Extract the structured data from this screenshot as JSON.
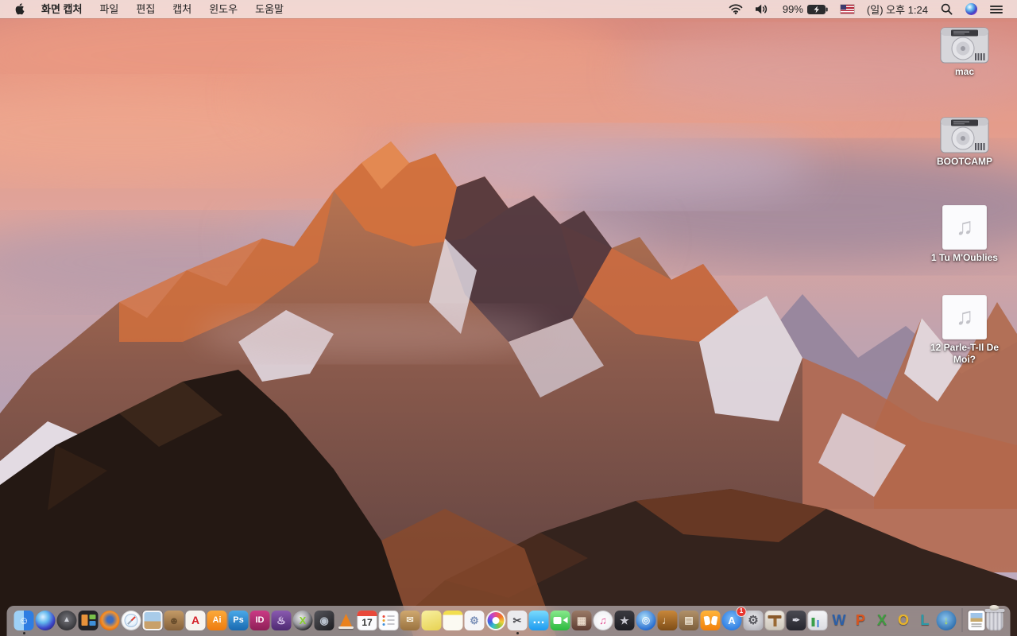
{
  "menu_bar": {
    "app_name": "화면 캡처",
    "menus": [
      "파일",
      "편집",
      "캡처",
      "윈도우",
      "도움말"
    ],
    "status": {
      "battery_percent": "99%",
      "clock": "(일) 오후 1:24",
      "icons": [
        "wifi-icon",
        "volume-icon",
        "battery-charging-icon",
        "us-flag-input-icon",
        "spotlight-search-icon",
        "siri-icon",
        "notification-center-icon"
      ]
    }
  },
  "desktop": {
    "icons": [
      {
        "name": "volume-mac",
        "label": "mac",
        "type": "hard-drive"
      },
      {
        "name": "volume-bootcamp",
        "label": "BOOTCAMP",
        "type": "hard-drive"
      },
      {
        "name": "audio-file-1",
        "label": "1 Tu M'Oublies",
        "type": "audio-file"
      },
      {
        "name": "audio-file-12",
        "label": "12 Parle-T-Il De Moi?",
        "type": "audio-file"
      }
    ]
  },
  "dock": {
    "items": [
      {
        "name": "finder",
        "label": "Finder",
        "special": "finder",
        "glyph": "☺",
        "gc": "#ffffff",
        "fs": 13,
        "running": true
      },
      {
        "name": "siri",
        "label": "Siri",
        "shape": "c",
        "bg": "radial-gradient(circle at 38% 32%,#cfeaff 4%,#62b8ee 32%,#3d46c9 62%,#21174a 95%)"
      },
      {
        "name": "launchpad",
        "label": "Launchpad",
        "shape": "c",
        "bg": "radial-gradient(circle at 50% 42%,#76767c,#303034 78%)",
        "glyph": "▲",
        "gc": "#cfd2da",
        "fs": 10
      },
      {
        "name": "mission-control",
        "label": "Mission Control",
        "special": "mc"
      },
      {
        "name": "firefox",
        "label": "Firefox",
        "shape": "c",
        "bg": "radial-gradient(circle at 52% 46%,#3d6cbf 20%,#f2932f 52%,#d95b00 82%)"
      },
      {
        "name": "safari",
        "label": "Safari",
        "special": "safari"
      },
      {
        "name": "preview",
        "label": "Preview",
        "special": "preview"
      },
      {
        "name": "contacts",
        "label": "Contacts",
        "shape": "r",
        "bg": "linear-gradient(180deg,#c39a66,#85613a)",
        "glyph": "☻",
        "gc": "rgba(58,40,16,0.55)",
        "fs": 13
      },
      {
        "name": "acrobat",
        "label": "Adobe Acrobat",
        "shape": "r",
        "bg": "#f7f4ef",
        "glyph": "A",
        "gc": "#d42029",
        "fs": 14
      },
      {
        "name": "illustrator",
        "label": "Adobe Illustrator",
        "shape": "r",
        "bg": "linear-gradient(180deg,#fba93a,#ee7c10)",
        "glyph": "Ai",
        "gc": "#ffffff",
        "fs": 11
      },
      {
        "name": "photoshop",
        "label": "Adobe Photoshop",
        "shape": "r",
        "bg": "linear-gradient(180deg,#49a8e8,#1a6ab0)",
        "glyph": "Ps",
        "gc": "#ffffff",
        "fs": 11
      },
      {
        "name": "indesign",
        "label": "Adobe InDesign",
        "shape": "r",
        "bg": "linear-gradient(180deg,#cb3a85,#8e2057)",
        "glyph": "ID",
        "gc": "#ffffff",
        "fs": 11
      },
      {
        "name": "toast-titanium",
        "label": "Toast Titanium",
        "shape": "r",
        "bg": "linear-gradient(180deg,#8a5ab0,#4e2a72)",
        "glyph": "♨",
        "gc": "#e9d9f8",
        "fs": 13
      },
      {
        "name": "xld",
        "label": "XLD",
        "shape": "c",
        "bg": "radial-gradient(circle at 40% 35%,#ececec,#9a9aa0 45%,#1e1e22 78%)",
        "glyph": "X",
        "gc": "#86d02a",
        "fs": 13
      },
      {
        "name": "disc-burner",
        "label": "Disc Burner",
        "shape": "r",
        "bg": "linear-gradient(145deg,#55555b,#1c1c20)",
        "glyph": "◉",
        "gc": "#b8c0cc",
        "fs": 13
      },
      {
        "name": "vlc",
        "label": "VLC",
        "special": "vlc"
      },
      {
        "name": "calendar",
        "label": "Calendar",
        "special": "cal",
        "glyph": "17"
      },
      {
        "name": "reminders",
        "label": "Reminders",
        "special": "rem"
      },
      {
        "name": "unarchiver",
        "label": "Unarchiver",
        "shape": "r",
        "bg": "linear-gradient(180deg,#cfa86f,#9a7340)",
        "glyph": "✉",
        "gc": "#f4ecda",
        "fs": 11
      },
      {
        "name": "stickies",
        "label": "Stickies",
        "shape": "r",
        "bg": "linear-gradient(160deg,#f8f0a0,#e7d252)"
      },
      {
        "name": "notes",
        "label": "Notes",
        "shape": "r",
        "bg": "linear-gradient(180deg,#f2de4e 22%,#fbfaf2 22%)"
      },
      {
        "name": "image-capture",
        "label": "Image Capture",
        "shape": "r",
        "bg": "#f5f5f8",
        "glyph": "⚙",
        "gc": "#7a8fb8",
        "fs": 13
      },
      {
        "name": "photos",
        "label": "Photos",
        "special": "photos"
      },
      {
        "name": "grab",
        "label": "Grab",
        "shape": "r",
        "bg": "#ebebee",
        "glyph": "✂",
        "gc": "#4a4a50",
        "fs": 13,
        "running": true
      },
      {
        "name": "messages",
        "label": "Messages",
        "shape": "r",
        "bg": "linear-gradient(180deg,#7adafc,#1d9bf0)",
        "glyph": "…",
        "gc": "#ffffff",
        "fs": 16
      },
      {
        "name": "facetime",
        "label": "FaceTime",
        "special": "facetime"
      },
      {
        "name": "photo-booth",
        "label": "Photo Booth",
        "shape": "r",
        "bg": "linear-gradient(180deg,#9a7a66,#5e3d33)",
        "glyph": "▦",
        "gc": "#e9d9c9",
        "fs": 13
      },
      {
        "name": "itunes",
        "label": "iTunes",
        "special": "itunes",
        "glyph": "♫",
        "gc": "#e04a90",
        "fs": 13
      },
      {
        "name": "imovie",
        "label": "iMovie",
        "shape": "r",
        "bg": "linear-gradient(180deg,#3a3a40,#1e1e24)",
        "glyph": "★",
        "gc": "#c9c9d2",
        "fs": 13
      },
      {
        "name": "idvd",
        "label": "iDVD",
        "shape": "c",
        "bg": "radial-gradient(circle at 42% 35%,#aee0fa,#2a6fd0 70%,#1a4a9a)",
        "glyph": "◎",
        "gc": "rgba(255,255,255,0.85)",
        "fs": 12
      },
      {
        "name": "garageband",
        "label": "GarageBand",
        "shape": "r",
        "bg": "linear-gradient(180deg,#c8873a,#7d4d18)",
        "glyph": "♩",
        "gc": "#f4e2c4",
        "fs": 14
      },
      {
        "name": "pinboard-documents",
        "label": "Pinboard Documents",
        "shape": "r",
        "bg": "linear-gradient(180deg,#b09068,#7d5f3c)",
        "glyph": "▤",
        "gc": "#efe6d4",
        "fs": 12
      },
      {
        "name": "ibooks",
        "label": "iBooks",
        "special": "ibooks"
      },
      {
        "name": "app-store",
        "label": "App Store",
        "shape": "c",
        "bg": "radial-gradient(circle at 50% 40%,#7cbcf8,#2a7ae0 78%)",
        "glyph": "A",
        "gc": "#ffffff",
        "fs": 13,
        "badge": "1"
      },
      {
        "name": "system-preferences",
        "label": "System Preferences",
        "shape": "r",
        "bg": "radial-gradient(circle at 50% 40%,#ededf0,#b3b3ba 82%)",
        "glyph": "⚙",
        "gc": "#55555c",
        "fs": 15
      },
      {
        "name": "keynote",
        "label": "Keynote",
        "special": "keynote"
      },
      {
        "name": "pages",
        "label": "Pages",
        "shape": "r",
        "bg": "linear-gradient(180deg,#4a4a52,#26262e)",
        "glyph": "✒",
        "gc": "#d8d8e2",
        "fs": 12
      },
      {
        "name": "numbers",
        "label": "Numbers",
        "special": "numbers"
      },
      {
        "name": "ms-word",
        "label": "Microsoft Word",
        "glyph": "W",
        "gc": "#2b5fa8"
      },
      {
        "name": "ms-powerpoint",
        "label": "Microsoft PowerPoint",
        "glyph": "P",
        "gc": "#d9551f"
      },
      {
        "name": "ms-excel",
        "label": "Microsoft Excel",
        "glyph": "X",
        "gc": "#3f9e3f"
      },
      {
        "name": "ms-outlook",
        "label": "Microsoft Outlook",
        "glyph": "O",
        "gc": "#e8b42a"
      },
      {
        "name": "ms-lync",
        "label": "Microsoft Lync",
        "glyph": "L",
        "gc": "#2a9aa8"
      },
      {
        "name": "web-downloader",
        "label": "Web Downloader",
        "shape": "c",
        "bg": "radial-gradient(circle at 45% 40%,#8ac4ee,#2a6aaa 78%)",
        "glyph": "↓",
        "gc": "#b8e84a",
        "fs": 14
      },
      {
        "name": "divider",
        "kind": "divider"
      },
      {
        "name": "document-file",
        "label": "Document",
        "special": "docfile",
        "kind": "file"
      },
      {
        "name": "trash-full",
        "label": "Trash",
        "special": "trash",
        "kind": "trash"
      }
    ]
  },
  "colors": {
    "menu_bar_tint": "#f1e4e2",
    "dock_bg": "rgba(225,223,228,0.55)",
    "desktop_label": "#ffffff",
    "badge_red": "#e8352e"
  }
}
